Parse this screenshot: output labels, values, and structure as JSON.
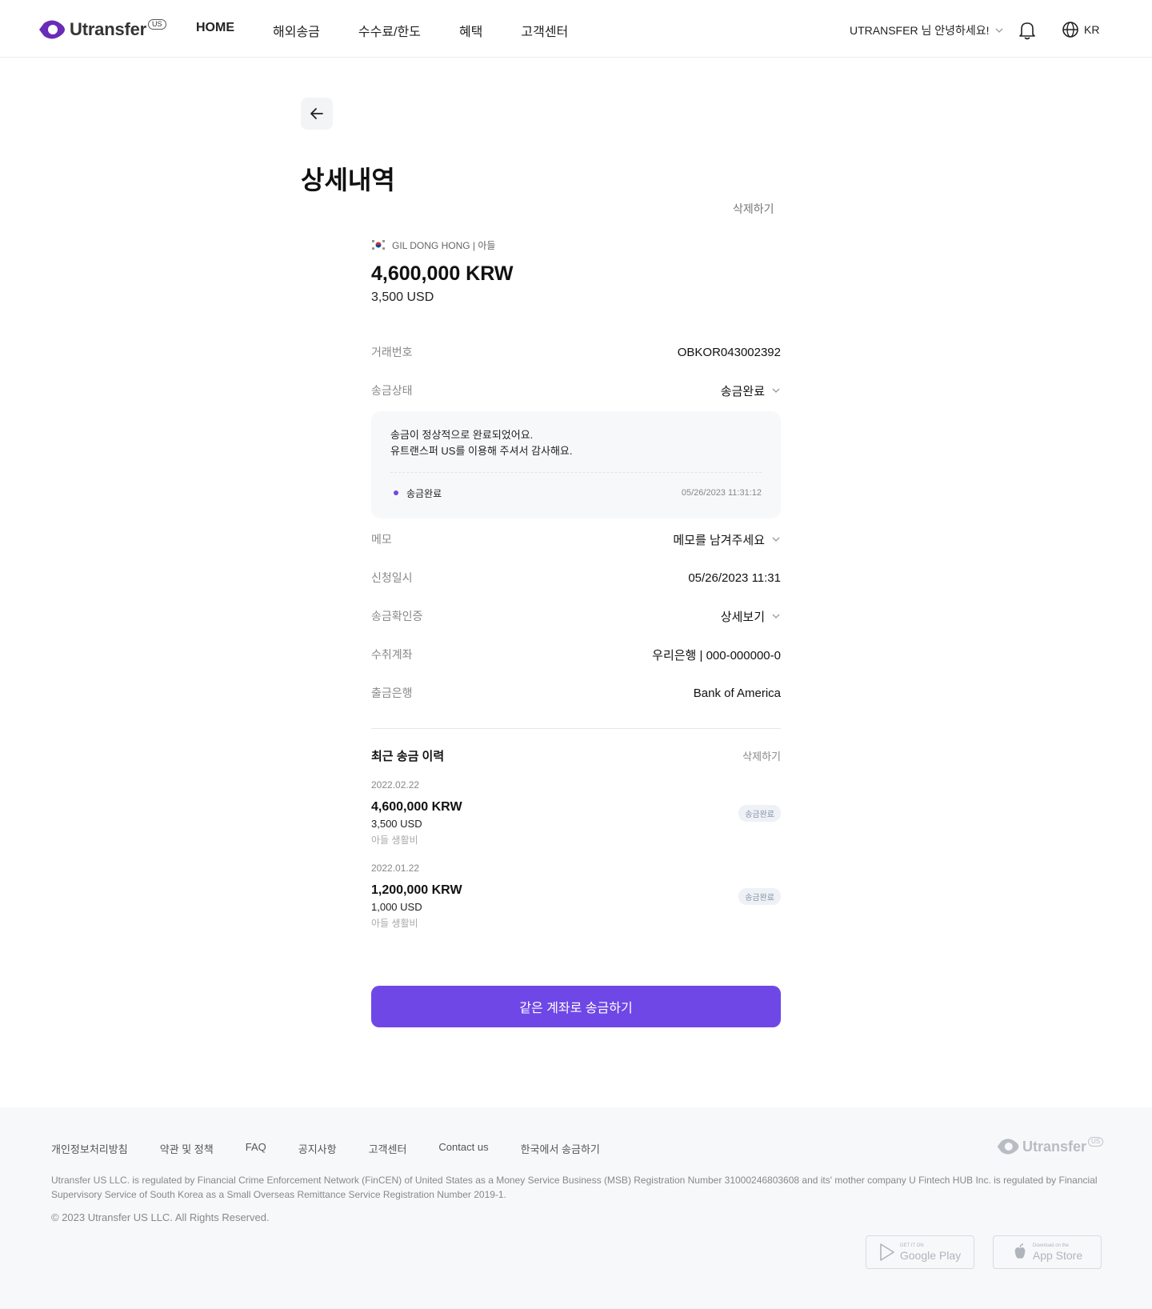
{
  "header": {
    "logo_text": "Utransfer",
    "logo_badge": "US",
    "nav": [
      "HOME",
      "해외송금",
      "수수료/한도",
      "혜택",
      "고객센터"
    ],
    "greeting": "UTRANSFER 님 안녕하세요!",
    "lang": "KR"
  },
  "page": {
    "title": "상세내역",
    "delete_label": "삭제하기"
  },
  "transfer": {
    "recipient": "GIL DONG HONG | 아들",
    "amount_krw": "4,600,000 KRW",
    "amount_usd": "3,500 USD"
  },
  "details": {
    "txn_label": "거래번호",
    "txn_value": "OBKOR043002392",
    "status_label": "송금상태",
    "status_value": "송금완료",
    "status_msg_1": "송금이 정상적으로 완료되었어요.",
    "status_msg_2": "유트랜스퍼 US를 이용해 주셔서 감사해요.",
    "step_label": "송금완료",
    "step_time": "05/26/2023 11:31:12",
    "memo_label": "메모",
    "memo_value": "메모를 남겨주세요",
    "date_label": "신청일시",
    "date_value": "05/26/2023 11:31",
    "cert_label": "송금확인증",
    "cert_value": "상세보기",
    "account_label": "수취계좌",
    "account_value": "우리은행 | 000-000000-0",
    "bank_label": "출금은행",
    "bank_value": "Bank of America"
  },
  "history": {
    "title": "최근 송금 이력",
    "delete_label": "삭제하기",
    "items": [
      {
        "date": "2022.02.22",
        "krw": "4,600,000 KRW",
        "usd": "3,500 USD",
        "memo": "아들 생활비",
        "badge": "송금완료"
      },
      {
        "date": "2022.01.22",
        "krw": "1,200,000 KRW",
        "usd": "1,000 USD",
        "memo": "아들 생활비",
        "badge": "송금완료"
      }
    ]
  },
  "cta_label": "같은 계좌로 송금하기",
  "footer": {
    "links": [
      "개인정보처리방침",
      "약관 및 정책",
      "FAQ",
      "공지사항",
      "고객센터",
      "Contact us",
      "한국에서 송금하기"
    ],
    "logo_text": "Utransfer",
    "logo_badge": "US",
    "regulation": "Utransfer US LLC. is regulated by Financial Crime Enforcement Network (FinCEN) of United States as a Money Service Business (MSB) Registration Number 31000246803608 and its' mother company U Fintech HUB Inc. is regulated by Financial Supervisory Service of South Korea as a Small Overseas Remittance Service Registration Number 2019-1.",
    "copyright": "© 2023 Utransfer US LLC. All Rights Reserved.",
    "google_small": "GET IT ON",
    "google_big": "Google Play",
    "apple_small": "Download on the",
    "apple_big": "App Store"
  },
  "colors": {
    "brand": "#6f47e6",
    "logo": "#6a2bb8"
  }
}
